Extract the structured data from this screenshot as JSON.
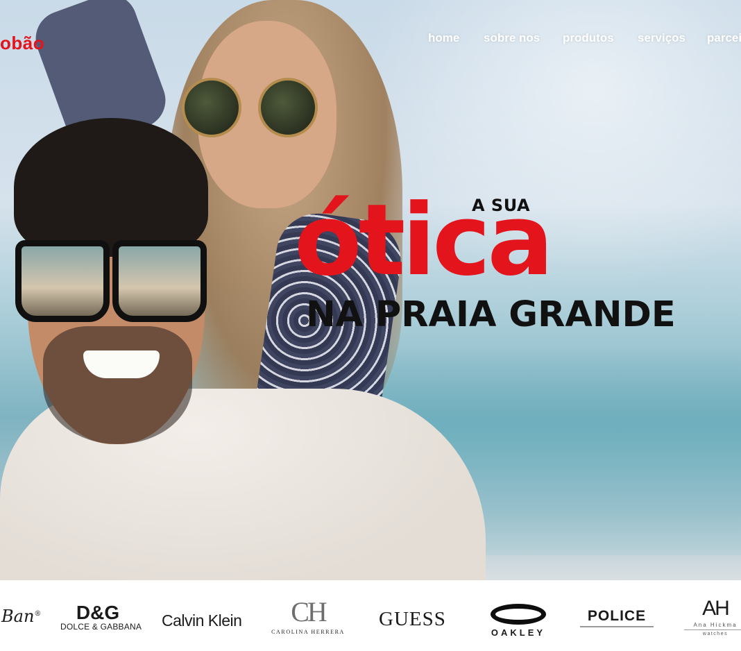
{
  "header": {
    "logo_text": "obão",
    "nav": {
      "home": "home",
      "sobre": "sobre nos",
      "produtos": "produtos",
      "servicos": "serviços",
      "parceiros": "parcei"
    }
  },
  "hero": {
    "line1": "A SUA",
    "line2": "ótica",
    "line3": "NA PRAIA GRANDE"
  },
  "brands": {
    "rayban": "Ban",
    "rayban_mark": "®",
    "dg_mark": "D&G",
    "dg_text": "DOLCE & GABBANA",
    "calvin_klein": "Calvin Klein",
    "ch_mark": "CH",
    "ch_text": "CAROLINA HERRERA",
    "guess": "GUESS",
    "oakley": "OAKLEY",
    "police": "POLICE",
    "ah_mark": "AH",
    "ah_name": "Ana Hickma",
    "ah_sub": "watches"
  },
  "colors": {
    "accent": "#e3141c",
    "headline_dark": "#111111",
    "nav_text": "#ffffff"
  }
}
